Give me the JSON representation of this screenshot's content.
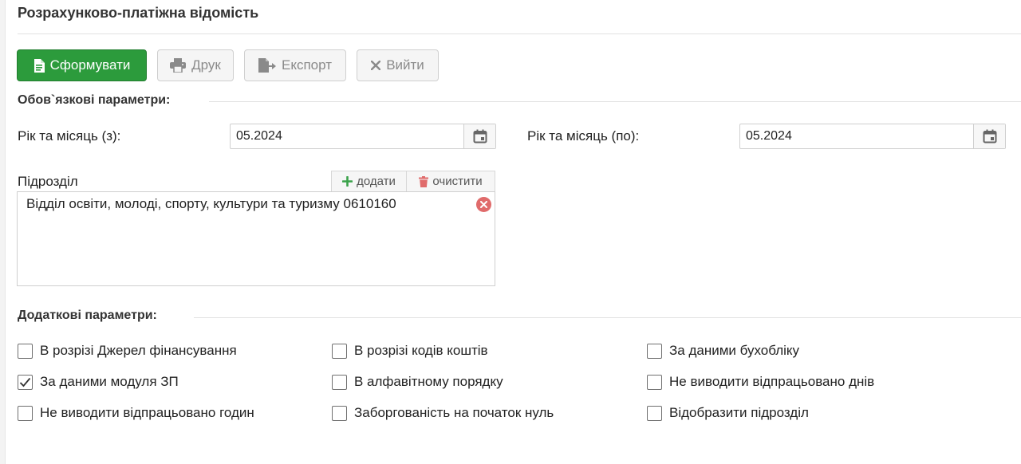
{
  "page": {
    "title": "Розрахунково-платіжна відомість"
  },
  "toolbar": {
    "form_label": "Сформувати",
    "print_label": "Друк",
    "export_label": "Експорт",
    "exit_label": "Вийти"
  },
  "required_params": {
    "title": "Обов`язкові параметри:",
    "date_from": {
      "label": "Рік та місяць (з):",
      "value": "05.2024"
    },
    "date_to": {
      "label": "Рік та місяць (по):",
      "value": "05.2024"
    },
    "division": {
      "label": "Підрозділ",
      "add_label": "додати",
      "clear_label": "очистити",
      "items": [
        "Відділ освіти, молоді, спорту, культури та туризму 0610160"
      ]
    }
  },
  "additional_params": {
    "title": "Додаткові параметри:",
    "options": [
      {
        "label": "В розрізі Джерел фінансування",
        "checked": false
      },
      {
        "label": "В розрізі кодів коштів",
        "checked": false
      },
      {
        "label": "За даними бухобліку",
        "checked": false
      },
      {
        "label": "За даними модуля ЗП",
        "checked": true
      },
      {
        "label": "В алфавітному порядку",
        "checked": false
      },
      {
        "label": "Не виводити відпрацьовано днів",
        "checked": false
      },
      {
        "label": "Не виводити відпрацьовано годин",
        "checked": false
      },
      {
        "label": "Заборгованість на початок нуль",
        "checked": false
      },
      {
        "label": "Відобразити підрозділ",
        "checked": false
      }
    ]
  },
  "colors": {
    "primary": "#2c9b3c",
    "add_icon": "#3aa24a",
    "danger_icon": "#e06b6b"
  }
}
